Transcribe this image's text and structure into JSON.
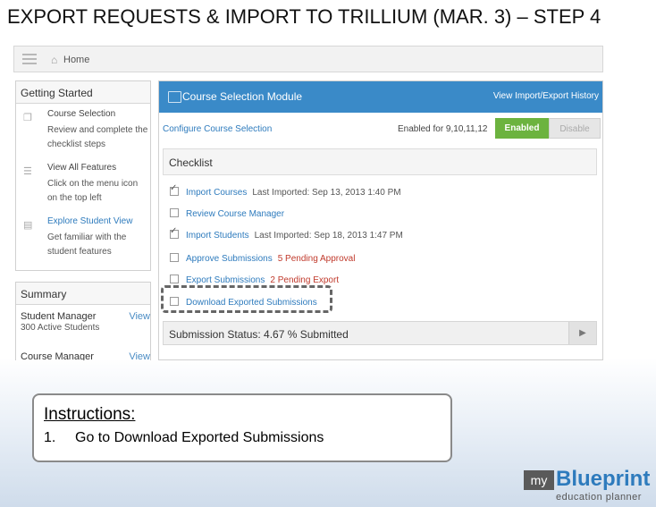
{
  "slide": {
    "title": "EXPORT REQUESTS & IMPORT TO TRILLIUM (MAR. 3) – STEP 4"
  },
  "topbar": {
    "menu_icon": "hamburger-menu-icon",
    "home_icon": "home-icon",
    "home_label": "Home"
  },
  "getting_started": {
    "heading": "Getting Started",
    "items": [
      {
        "icon": "documents-icon",
        "title": "Course Selection",
        "desc": "Review and complete the checklist steps"
      },
      {
        "icon": "menu-list-icon",
        "title": "View All Features",
        "desc": "Click on the menu icon on the top left"
      },
      {
        "icon": "id-card-icon",
        "title": "Explore Student View",
        "desc": "Get familiar with the student features"
      }
    ]
  },
  "summary": {
    "heading": "Summary",
    "rows": [
      {
        "name": "Student Manager",
        "view": "View",
        "sub": "300 Active Students"
      },
      {
        "name": "Course Manager",
        "view": "View",
        "sub": ""
      }
    ]
  },
  "module": {
    "title": "Course Selection Module",
    "history_link": "View Import/Export History",
    "config_link": "Configure Course Selection",
    "enabled_for": "Enabled for 9,10,11,12",
    "enabled_btn": "Enabled",
    "disable_btn": "Disable",
    "checklist_heading": "Checklist",
    "checklist": [
      {
        "label": "Import Courses",
        "note": "Last Imported: Sep 13, 2013 1:40 PM",
        "checked": true,
        "note_color": "gray"
      },
      {
        "label": "Review Course Manager",
        "note": "",
        "checked": false,
        "note_color": "gray"
      },
      {
        "label": "Import Students",
        "note": "Last Imported: Sep 18, 2013 1:47 PM",
        "checked": true,
        "note_color": "gray"
      },
      {
        "label": "Approve Submissions",
        "note": "5 Pending Approval",
        "checked": false,
        "note_color": "red"
      },
      {
        "label": "Export Submissions",
        "note": "2 Pending Export",
        "checked": false,
        "note_color": "red"
      },
      {
        "label": "Download Exported Submissions",
        "note": "",
        "checked": false,
        "note_color": "gray"
      }
    ],
    "status": "Submission Status: 4.67 % Submitted"
  },
  "instructions": {
    "title": "Instructions:",
    "step_num": "1.",
    "step_text": "Go to Download Exported Submissions"
  },
  "logo": {
    "my": "my",
    "brand": "Blueprint",
    "tagline": "education planner",
    "brand_color": "#2e7bbd"
  }
}
